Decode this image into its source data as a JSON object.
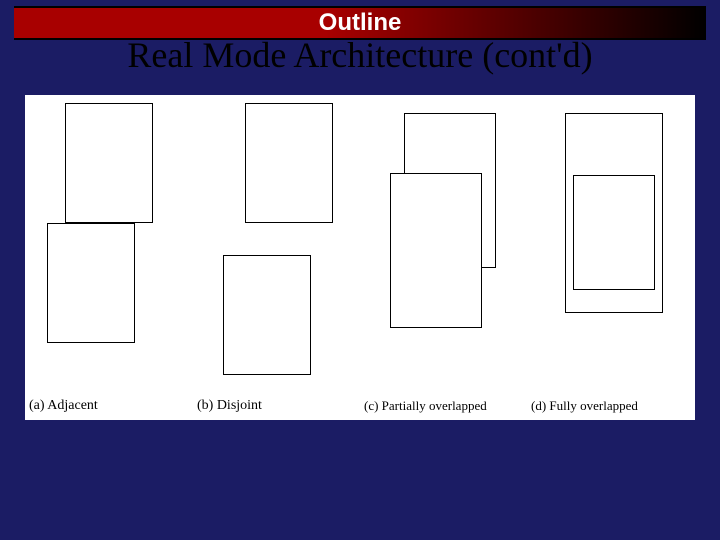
{
  "banner": {
    "title": "Outline"
  },
  "subtitle": "Real Mode Architecture (cont'd)",
  "figure": {
    "captions": {
      "a": "(a) Adjacent",
      "b": "(b) Disjoint",
      "c": "(c) Partially overlapped",
      "d": "(d) Fully overlapped"
    }
  }
}
